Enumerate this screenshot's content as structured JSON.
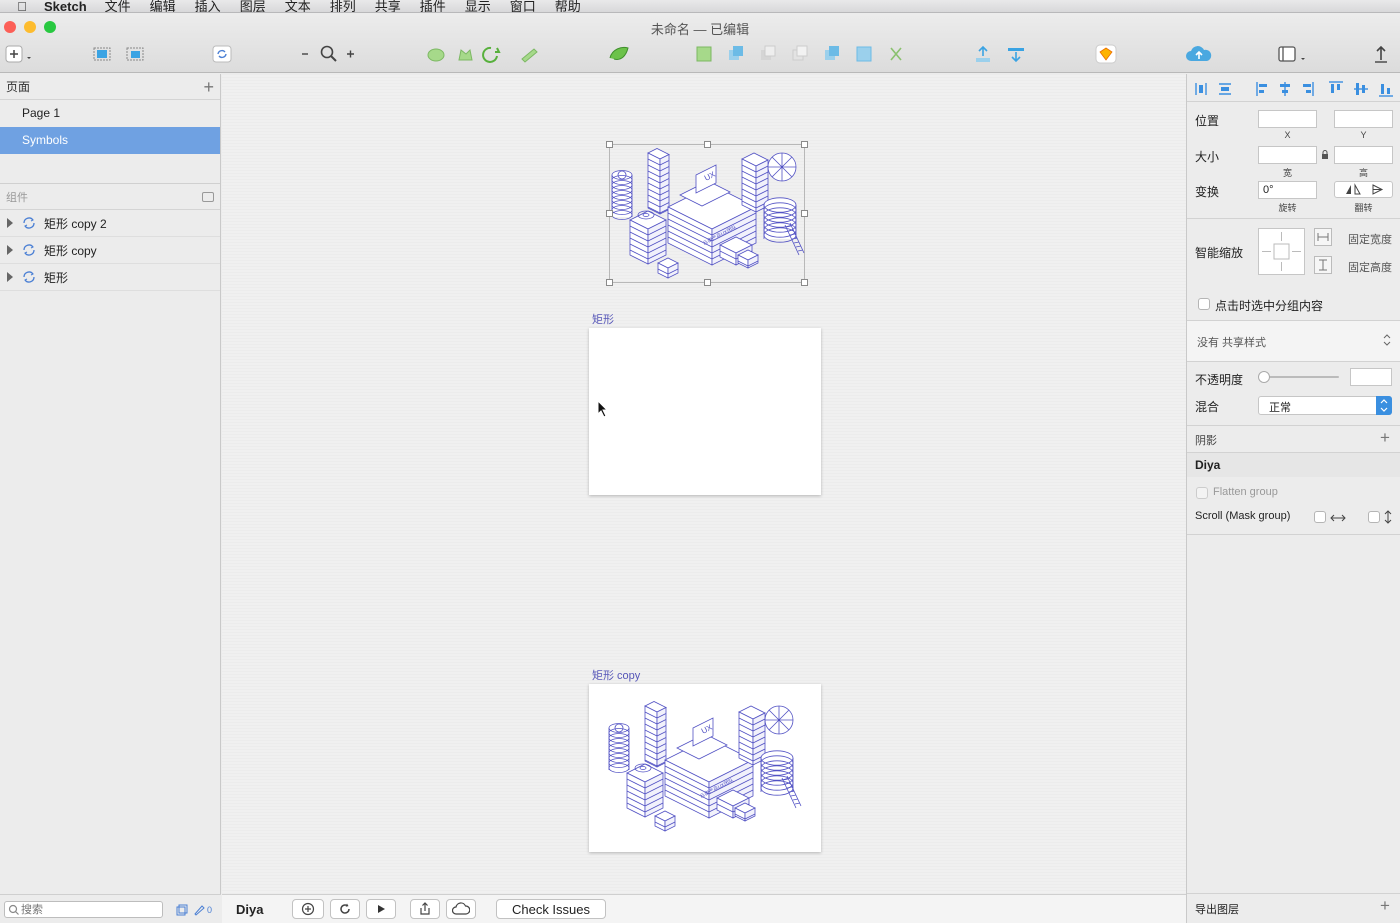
{
  "menubar": {
    "app_name": "Sketch",
    "items": [
      "文件",
      "编辑",
      "插入",
      "图层",
      "文本",
      "排列",
      "共享",
      "插件",
      "显示",
      "窗口",
      "帮助"
    ]
  },
  "window": {
    "title": "未命名 — 已编辑"
  },
  "left_panel": {
    "pages_header": "页面",
    "pages": [
      "Page 1",
      "Symbols"
    ],
    "selected_page": "Symbols",
    "components_header": "组件",
    "layers": [
      "矩形 copy 2",
      "矩形 copy",
      "矩形"
    ],
    "search_placeholder": "搜索",
    "filter_count": "0"
  },
  "canvas": {
    "artboard1_label": "矩形",
    "artboard2_label": "矩形 copy",
    "illustration_banner": "云南产品UX团队",
    "illustration_screen": "UX"
  },
  "bottom_bar": {
    "plugin_label": "Diya",
    "check_issues_label": "Check Issues"
  },
  "inspector": {
    "position_label": "位置",
    "x_label": "X",
    "y_label": "Y",
    "size_label": "大小",
    "width_label": "宽",
    "height_label": "高",
    "transform_label": "变换",
    "rotation_value": "0°",
    "rotate_label": "旋转",
    "flip_label": "翻转",
    "resizing_label": "智能缩放",
    "fix_width_label": "固定宽度",
    "fix_height_label": "固定高度",
    "select_group_label": "点击时选中分组内容",
    "shared_style_label": "没有 共享样式",
    "opacity_label": "不透明度",
    "blend_label": "混合",
    "blend_value": "正常",
    "shadow_label": "阴影",
    "diya_header": "Diya",
    "flatten_group_label": "Flatten group",
    "scroll_label": "Scroll (Mask group)",
    "export_label": "导出图层"
  },
  "colors": {
    "selection_blue": "#6fa1e2",
    "illustration_stroke": "#5252c4",
    "toolbar_green": "#6cc24a"
  }
}
